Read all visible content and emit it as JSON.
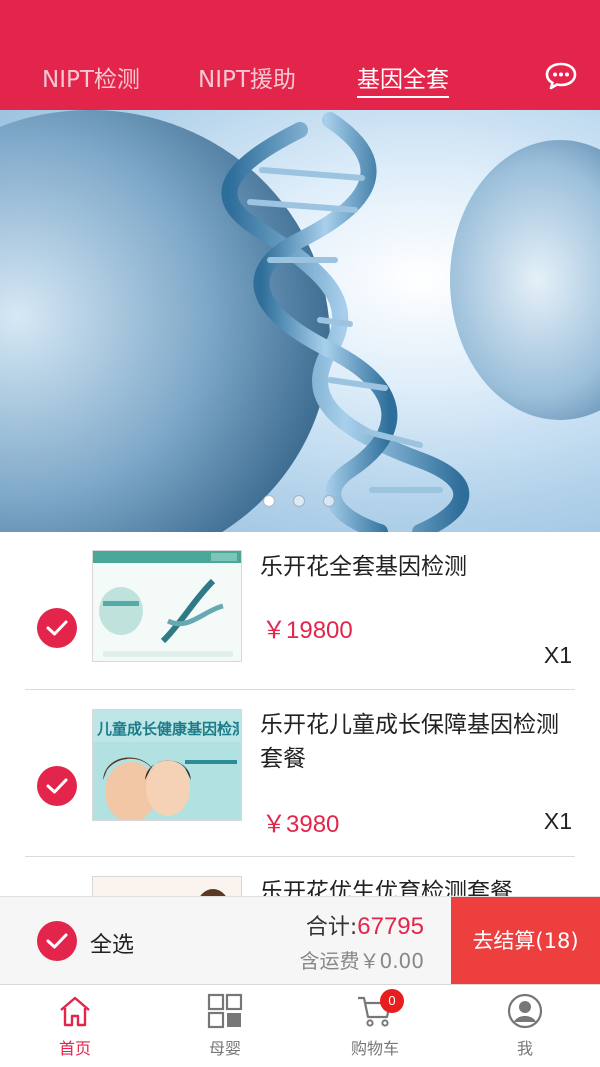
{
  "header": {
    "tabs": [
      {
        "label": "NIPT检测",
        "active": false
      },
      {
        "label": "NIPT援助",
        "active": false
      },
      {
        "label": "基因全套",
        "active": true
      }
    ],
    "message_icon": "chat-bubble-icon",
    "bg_color": "#e3254b"
  },
  "banner": {
    "slide_count": 3,
    "active_slide": 1
  },
  "cart_items": [
    {
      "title": "乐开花全套基因检测",
      "price": "￥19800",
      "qty": "X1",
      "checked": true
    },
    {
      "title": "乐开花儿童成长保障基因检测套餐",
      "price": "￥3980",
      "qty": "X1",
      "checked": true,
      "thumb_text": "儿童成长健康基因检测"
    },
    {
      "title": "乐开花优生优育检测套餐",
      "checked": true
    }
  ],
  "checkout": {
    "select_all_label": "全选",
    "total_prefix": "合计:",
    "total_amount": "67795",
    "shipping_label": "含运费￥0.00",
    "pay_button_label": "去结算(18)"
  },
  "bottom_nav": [
    {
      "label": "首页",
      "icon": "home-icon",
      "active": true
    },
    {
      "label": "母婴",
      "icon": "grid-icon",
      "active": false
    },
    {
      "label": "购物车",
      "icon": "cart-icon",
      "active": false,
      "badge": "0"
    },
    {
      "label": "我",
      "icon": "user-icon",
      "active": false
    }
  ],
  "colors": {
    "accent": "#e3254b",
    "pay_button": "#ee3f3f"
  }
}
